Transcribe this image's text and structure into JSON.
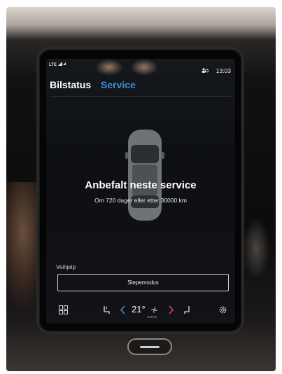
{
  "statusbar": {
    "signal": "LTE",
    "time": "13:03"
  },
  "tabs": [
    {
      "label": "Bilstatus",
      "active": false
    },
    {
      "label": "Service",
      "active": true
    }
  ],
  "service": {
    "title": "Anbefalt neste service",
    "subtitle": "Om 720 dager eller etter 30000 km"
  },
  "assistance": {
    "label": "Veihjelp",
    "tow_button": "Slepemodus"
  },
  "climate": {
    "temperature": "21°",
    "mode": "AUTO"
  },
  "colors": {
    "accent": "#3d8fd6",
    "screen_bg": "#0d0f12"
  },
  "icons": [
    "app-grid-icon",
    "seat-heat-icon",
    "chevron-left-icon",
    "fan-icon",
    "chevron-right-icon",
    "seat-icon",
    "settings-icon"
  ]
}
